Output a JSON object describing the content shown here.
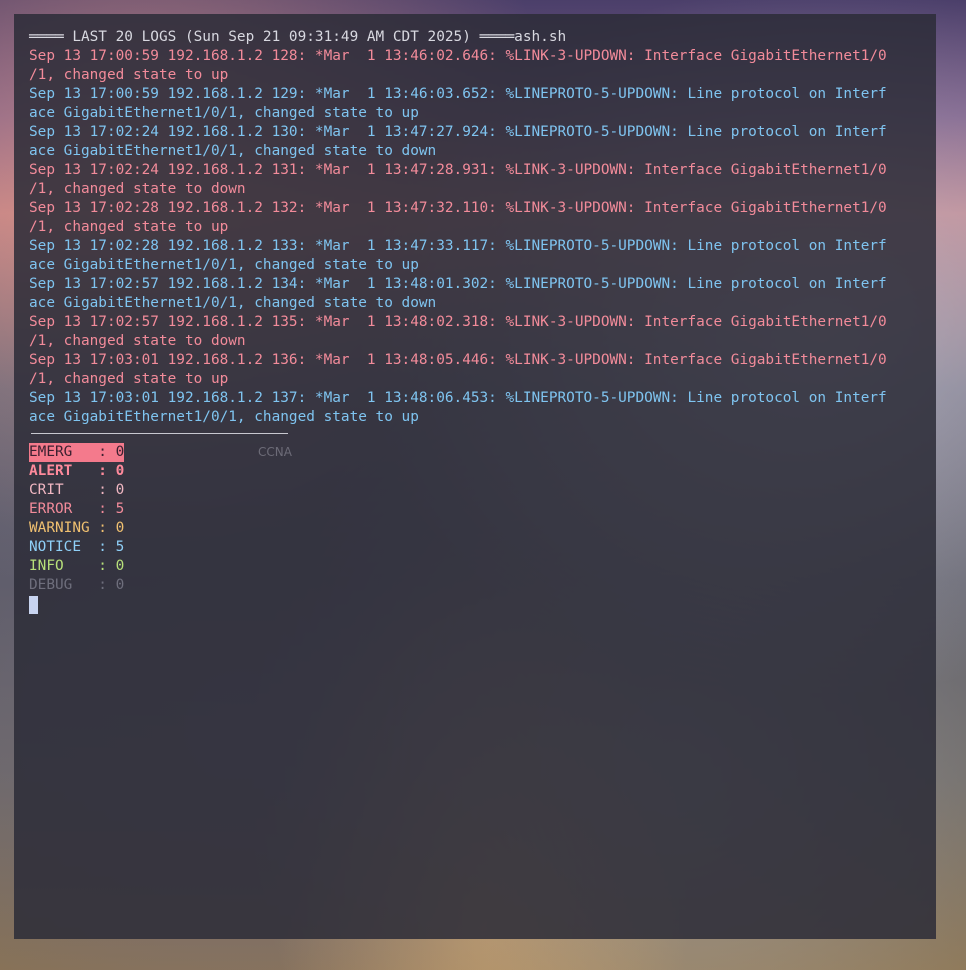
{
  "header": "════ LAST 20 LOGS (Sun Sep 21 09:31:49 AM CDT 2025) ════ash.sh",
  "logs": [
    {
      "text": "Sep 13 17:00:59 192.168.1.2 128: *Mar  1 13:46:02.646: %LINK-3-UPDOWN: Interface GigabitEthernet1/0",
      "cont": "/1, changed state to up",
      "level": "error"
    },
    {
      "text": "Sep 13 17:00:59 192.168.1.2 129: *Mar  1 13:46:03.652: %LINEPROTO-5-UPDOWN: Line protocol on Interf",
      "cont": "ace GigabitEthernet1/0/1, changed state to up",
      "level": "notice"
    },
    {
      "text": "Sep 13 17:02:24 192.168.1.2 130: *Mar  1 13:47:27.924: %LINEPROTO-5-UPDOWN: Line protocol on Interf",
      "cont": "ace GigabitEthernet1/0/1, changed state to down",
      "level": "notice"
    },
    {
      "text": "Sep 13 17:02:24 192.168.1.2 131: *Mar  1 13:47:28.931: %LINK-3-UPDOWN: Interface GigabitEthernet1/0",
      "cont": "/1, changed state to down",
      "level": "error"
    },
    {
      "text": "Sep 13 17:02:28 192.168.1.2 132: *Mar  1 13:47:32.110: %LINK-3-UPDOWN: Interface GigabitEthernet1/0",
      "cont": "/1, changed state to up",
      "level": "error"
    },
    {
      "text": "Sep 13 17:02:28 192.168.1.2 133: *Mar  1 13:47:33.117: %LINEPROTO-5-UPDOWN: Line protocol on Interf",
      "cont": "ace GigabitEthernet1/0/1, changed state to up",
      "level": "notice"
    },
    {
      "text": "Sep 13 17:02:57 192.168.1.2 134: *Mar  1 13:48:01.302: %LINEPROTO-5-UPDOWN: Line protocol on Interf",
      "cont": "ace GigabitEthernet1/0/1, changed state to down",
      "level": "notice"
    },
    {
      "text": "Sep 13 17:02:57 192.168.1.2 135: *Mar  1 13:48:02.318: %LINK-3-UPDOWN: Interface GigabitEthernet1/0",
      "cont": "/1, changed state to down",
      "level": "error"
    },
    {
      "text": "Sep 13 17:03:01 192.168.1.2 136: *Mar  1 13:48:05.446: %LINK-3-UPDOWN: Interface GigabitEthernet1/0",
      "cont": "/1, changed state to up",
      "level": "error"
    },
    {
      "text": "Sep 13 17:03:01 192.168.1.2 137: *Mar  1 13:48:06.453: %LINEPROTO-5-UPDOWN: Line protocol on Interf",
      "cont": "ace GigabitEthernet1/0/1, changed state to up",
      "level": "notice"
    }
  ],
  "summary": [
    {
      "label": "EMERG   : 0",
      "level": "emerg"
    },
    {
      "label": "ALERT   : 0",
      "level": "alert"
    },
    {
      "label": "CRIT    : 0",
      "level": "crit"
    },
    {
      "label": "ERROR   : 5",
      "level": "error"
    },
    {
      "label": "WARNING : 0",
      "level": "warning"
    },
    {
      "label": "NOTICE  : 5",
      "level": "notice"
    },
    {
      "label": "INFO    : 0",
      "level": "info"
    },
    {
      "label": "DEBUG   : 0",
      "level": "debug"
    }
  ],
  "watermark": "CCNA",
  "colors": {
    "error": "#f28b9a",
    "notice": "#7fc4f0",
    "emerg_bg": "#f47a8c",
    "warning": "#f0c070",
    "info": "#b7e07a",
    "debug": "#6e6e7c"
  }
}
